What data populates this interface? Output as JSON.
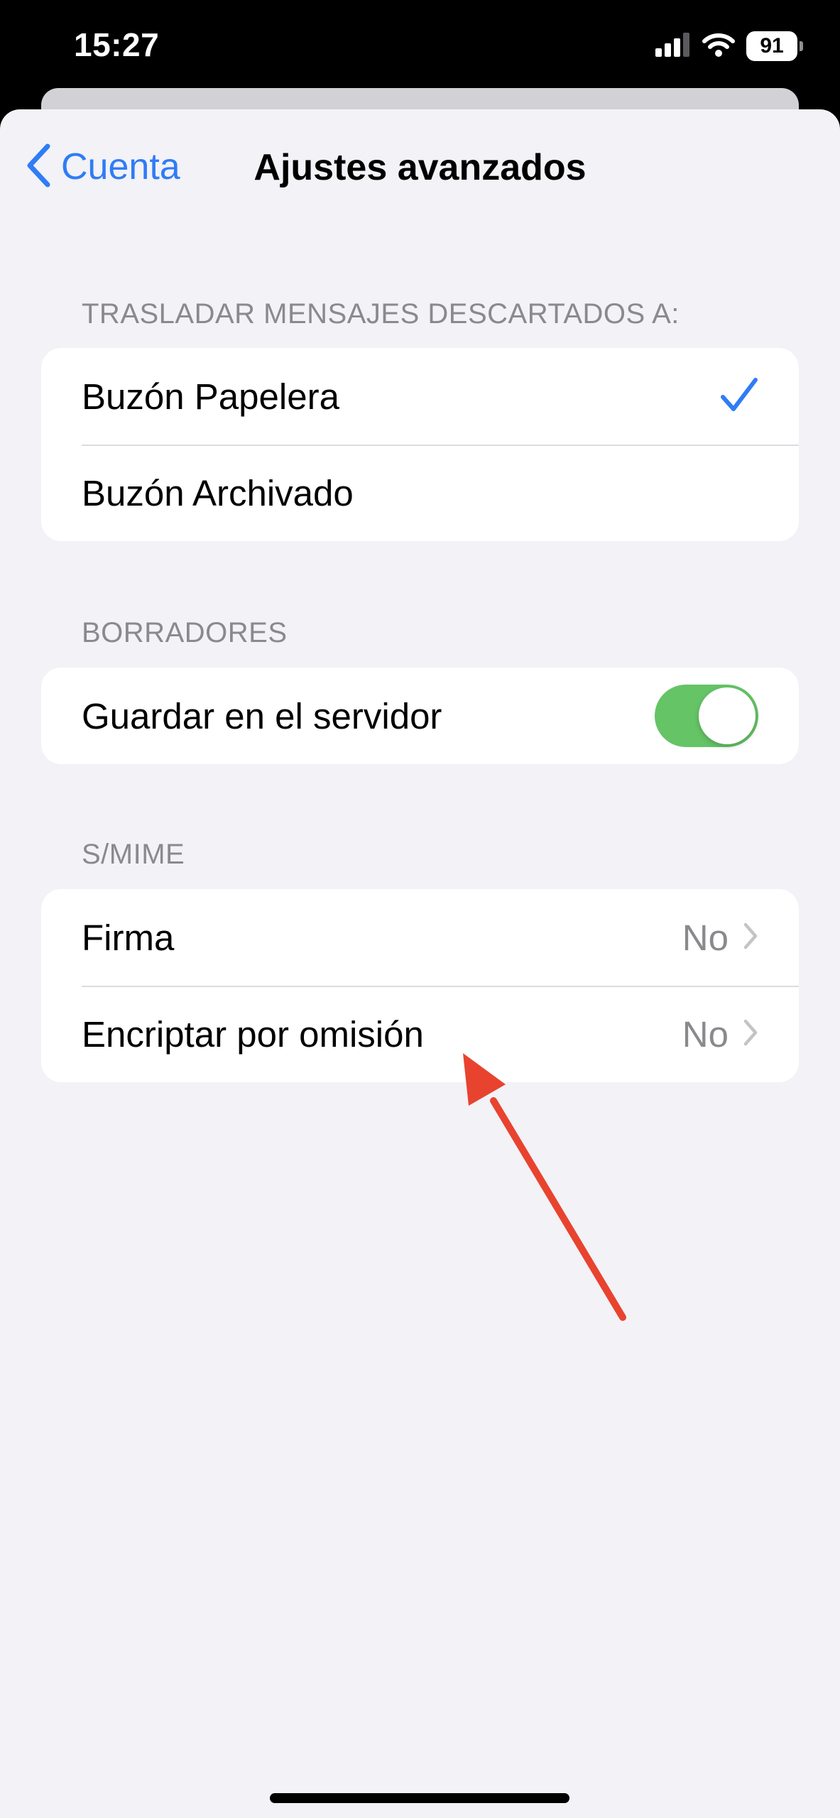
{
  "status_bar": {
    "time": "15:27",
    "battery": "91"
  },
  "nav": {
    "back_label": "Cuenta",
    "title": "Ajustes avanzados"
  },
  "sections": {
    "discarded": {
      "header": "TRASLADAR MENSAJES DESCARTADOS A:",
      "items": [
        {
          "label": "Buzón Papelera",
          "selected": true
        },
        {
          "label": "Buzón Archivado",
          "selected": false
        }
      ]
    },
    "drafts": {
      "header": "BORRADORES",
      "items": [
        {
          "label": "Guardar en el servidor",
          "toggle_on": true
        }
      ]
    },
    "smime": {
      "header": "S/MIME",
      "items": [
        {
          "label": "Firma",
          "value": "No"
        },
        {
          "label": "Encriptar por omisión",
          "value": "No"
        }
      ]
    }
  },
  "colors": {
    "accent": "#2f7cf6",
    "toggle_on": "#65c466",
    "annotation": "#e8432f"
  }
}
